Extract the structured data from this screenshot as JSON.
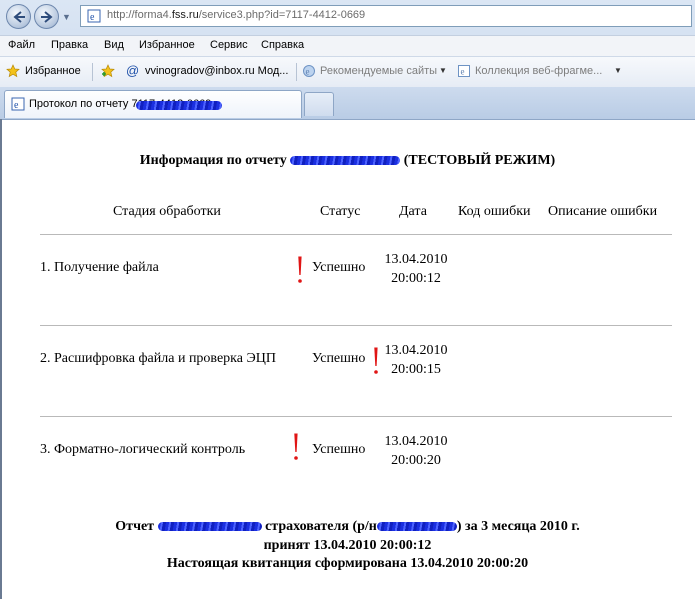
{
  "browser": {
    "url_prefix": "http://forma4.",
    "url_host": "fss.ru",
    "url_path": "/service3.php?id=7117-4412-0669",
    "menu": [
      "Файл",
      "Правка",
      "Вид",
      "Избранное",
      "Сервис",
      "Справка"
    ],
    "favorites": {
      "label": "Избранное",
      "items": [
        "vvinogradov@inbox.ru Мод...",
        "Рекомендуемые сайты",
        "Коллекция веб-фрагме..."
      ]
    },
    "tab": {
      "label": "Протокол по отчету 7117-4412-0669"
    },
    "accent": "#1b2fe0"
  },
  "report": {
    "title_prefix": "Информация по отчету",
    "title_suffix": "(ТЕСТОВЫЙ РЕЖИМ)",
    "columns": [
      "Стадия обработки",
      "Статус",
      "Дата",
      "Код ошибки",
      "Описание ошибки"
    ],
    "rows": [
      {
        "stage": "1. Получение файла",
        "status": "Успешно",
        "date": "13.04.2010",
        "time": "20:00:12"
      },
      {
        "stage": "2. Расшифровка файла и проверка ЭЦП",
        "status": "Успешно",
        "date": "13.04.2010",
        "time": "20:00:15"
      },
      {
        "stage": "3. Форматно-логический контроль",
        "status": "Успешно",
        "date": "13.04.2010",
        "time": "20:00:20"
      }
    ],
    "footer": {
      "line1_a": "Отчет",
      "line1_b": "страхователя (р/н",
      "line1_c": ") за 3 месяца 2010 г.",
      "line2": "принят 13.04.2010 20:00:12",
      "line3": "Настоящая квитанция сформирована 13.04.2010 20:00:20"
    },
    "warn_color": "#e01515"
  }
}
